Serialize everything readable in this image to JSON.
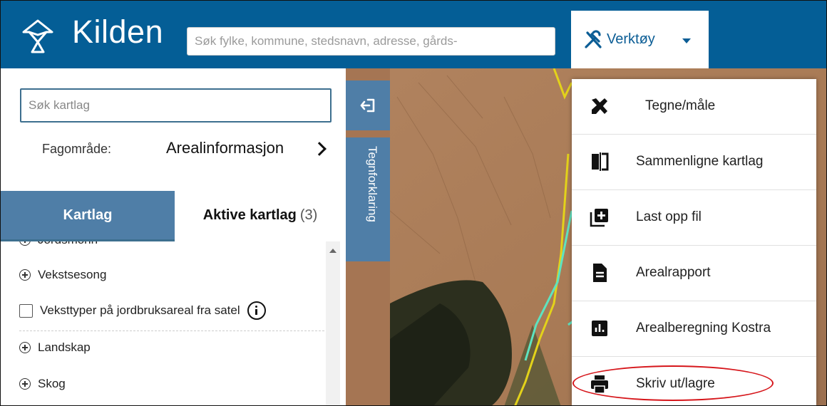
{
  "header": {
    "app_title": "Kilden",
    "search_placeholder": "Søk fylke, kommune, stedsnavn, adresse, gårds-",
    "tools_label": "Verktøy"
  },
  "panel": {
    "layer_search_placeholder": "Søk kartlag",
    "fag_label": "Fagområde:",
    "fag_value": "Arealinformasjon",
    "tabs": {
      "kartlag": "Kartlag",
      "aktive": "Aktive kartlag",
      "aktive_count": "(3)"
    },
    "list": [
      {
        "type": "group",
        "label": "Jordsmonn"
      },
      {
        "type": "group",
        "label": "Vekstsesong"
      },
      {
        "type": "layer",
        "label": "Veksttyper på jordbruksareal fra satel",
        "checked": false
      },
      {
        "type": "group",
        "label": "Landskap"
      },
      {
        "type": "group",
        "label": "Skog"
      }
    ]
  },
  "side_tabs": {
    "legend": "Tegnforklaring"
  },
  "menu": {
    "items": [
      {
        "label": "Tegne/måle",
        "icon": "ruler-pencil-icon"
      },
      {
        "label": "Sammenligne kartlag",
        "icon": "compare-icon"
      },
      {
        "label": "Last opp fil",
        "icon": "upload-file-icon"
      },
      {
        "label": "Arealrapport",
        "icon": "document-icon"
      },
      {
        "label": "Arealberegning Kostra",
        "icon": "bar-chart-icon"
      },
      {
        "label": "Skriv ut/lagre",
        "icon": "print-icon"
      }
    ]
  },
  "colors": {
    "header_bg": "#045e96",
    "tab_active_bg": "#4f7ea7",
    "highlight": "#d6161b"
  }
}
